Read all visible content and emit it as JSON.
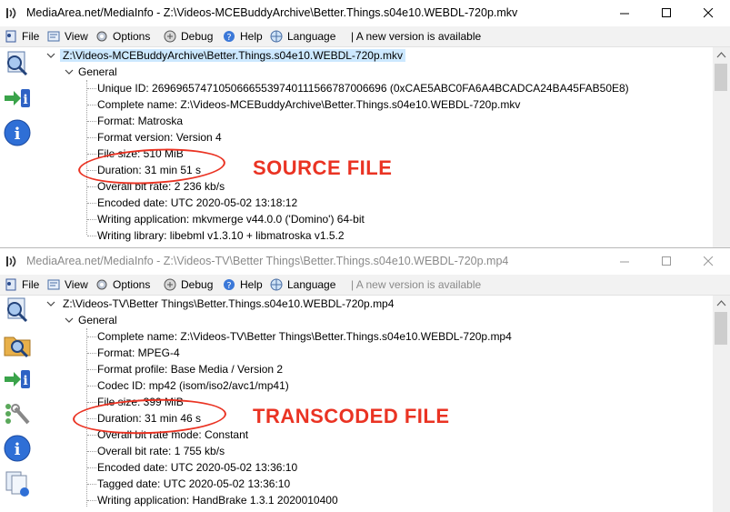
{
  "colors": {
    "annotation": "#ea3323",
    "selection": "#cce8ff",
    "menubar": "#f2f2f2"
  },
  "windows": [
    {
      "title": "MediaArea.net/MediaInfo - Z:\\Videos-MCEBuddyArchive\\Better.Things.s04e10.WEBDL-720p.mkv",
      "menu": {
        "file": "File",
        "view": "View",
        "options": "Options",
        "debug": "Debug",
        "help": "Help",
        "language": "Language",
        "notice": "| A new version is available"
      },
      "sidebar_icons": [
        "document-magnifier-icon",
        "import-info-icon",
        "info-icon"
      ],
      "tree": {
        "root": "Z:\\Videos-MCEBuddyArchive\\Better.Things.s04e10.WEBDL-720p.mkv",
        "section": "General",
        "items": [
          "Unique ID: 269696574710506665539740111566787006696 (0xCAE5ABC0FA6A4BCADCA24BA45FAB50E8)",
          "Complete name: Z:\\Videos-MCEBuddyArchive\\Better.Things.s04e10.WEBDL-720p.mkv",
          "Format: Matroska",
          "Format version: Version 4",
          "File size: 510 MiB",
          "Duration: 31 min 51 s",
          "Overall bit rate: 2 236 kb/s",
          "Encoded date: UTC 2020-05-02 13:18:12",
          "Writing application: mkvmerge v44.0.0 ('Domino') 64-bit",
          "Writing library: libebml v1.3.10 + libmatroska v1.5.2"
        ]
      },
      "annotation": "SOURCE FILE"
    },
    {
      "title": "MediaArea.net/MediaInfo - Z:\\Videos-TV\\Better Things\\Better.Things.s04e10.WEBDL-720p.mp4",
      "menu": {
        "file": "File",
        "view": "View",
        "options": "Options",
        "debug": "Debug",
        "help": "Help",
        "language": "Language",
        "notice": "| A new version is available"
      },
      "sidebar_icons": [
        "document-magnifier-icon",
        "folder-magnifier-icon",
        "import-info-icon",
        "preferences-icon",
        "info-icon",
        "export-icon"
      ],
      "tree": {
        "root": "Z:\\Videos-TV\\Better Things\\Better.Things.s04e10.WEBDL-720p.mp4",
        "section": "General",
        "items": [
          "Complete name: Z:\\Videos-TV\\Better Things\\Better.Things.s04e10.WEBDL-720p.mp4",
          "Format: MPEG-4",
          "Format profile: Base Media / Version 2",
          "Codec ID: mp42 (isom/iso2/avc1/mp41)",
          "File size: 399 MiB",
          "Duration: 31 min 46 s",
          "Overall bit rate mode: Constant",
          "Overall bit rate: 1 755 kb/s",
          "Encoded date: UTC 2020-05-02 13:36:10",
          "Tagged date: UTC 2020-05-02 13:36:10",
          "Writing application: HandBrake 1.3.1 2020010400"
        ]
      },
      "annotation": "TRANSCODED FILE"
    }
  ]
}
